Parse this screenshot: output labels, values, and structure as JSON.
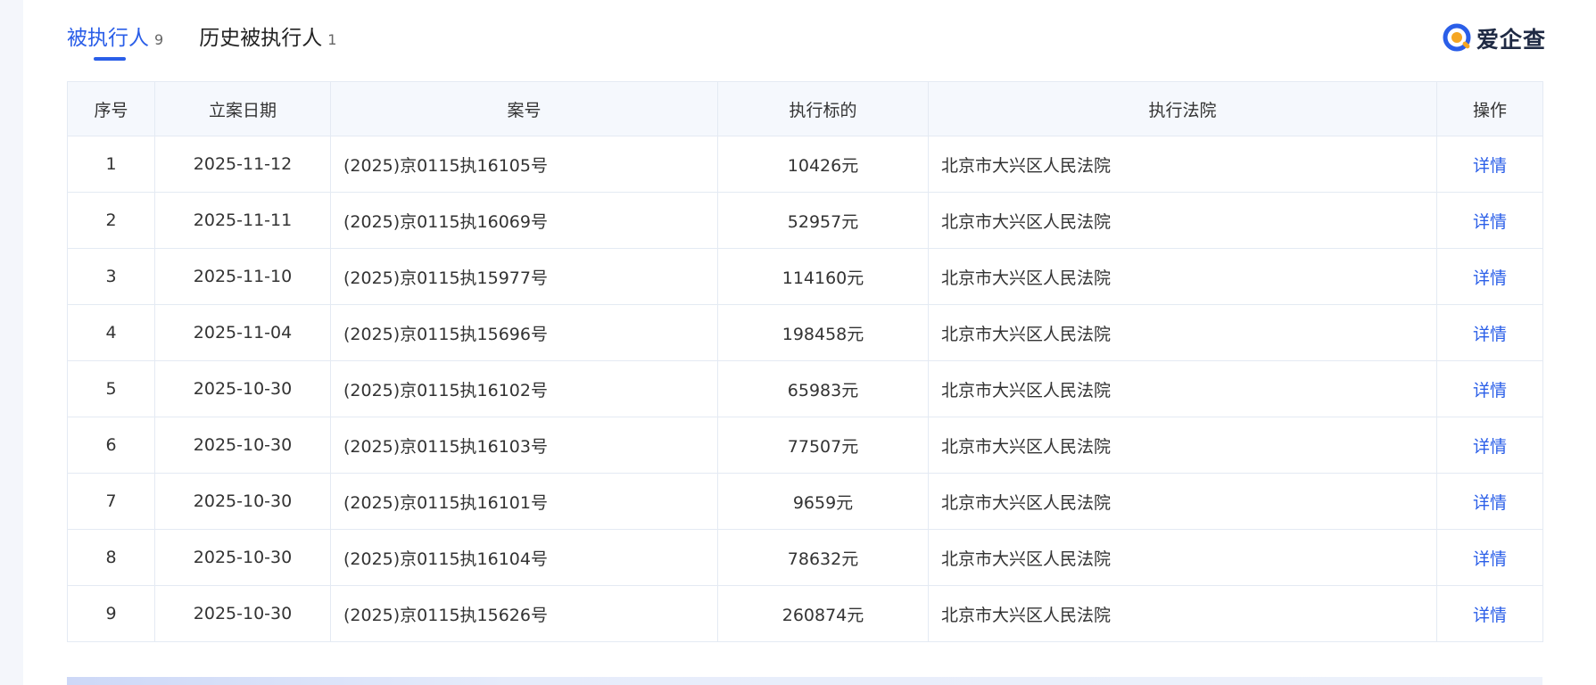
{
  "tabs": [
    {
      "label": "被执行人",
      "count": "9",
      "active": true
    },
    {
      "label": "历史被执行人",
      "count": "1",
      "active": false
    }
  ],
  "brand": {
    "name": "爱企查",
    "accent": "#2a5ee8",
    "logo_colors": [
      "#2a5ee8",
      "#f5a623"
    ]
  },
  "table": {
    "headers": {
      "index": "序号",
      "date": "立案日期",
      "case_no": "案号",
      "amount": "执行标的",
      "court": "执行法院",
      "action": "操作"
    },
    "rows": [
      {
        "index": "1",
        "date": "2025-11-12",
        "case_no": "(2025)京0115执16105号",
        "amount": "10426元",
        "court": "北京市大兴区人民法院",
        "action": "详情"
      },
      {
        "index": "2",
        "date": "2025-11-11",
        "case_no": "(2025)京0115执16069号",
        "amount": "52957元",
        "court": "北京市大兴区人民法院",
        "action": "详情"
      },
      {
        "index": "3",
        "date": "2025-11-10",
        "case_no": "(2025)京0115执15977号",
        "amount": "114160元",
        "court": "北京市大兴区人民法院",
        "action": "详情"
      },
      {
        "index": "4",
        "date": "2025-11-04",
        "case_no": "(2025)京0115执15696号",
        "amount": "198458元",
        "court": "北京市大兴区人民法院",
        "action": "详情"
      },
      {
        "index": "5",
        "date": "2025-10-30",
        "case_no": "(2025)京0115执16102号",
        "amount": "65983元",
        "court": "北京市大兴区人民法院",
        "action": "详情"
      },
      {
        "index": "6",
        "date": "2025-10-30",
        "case_no": "(2025)京0115执16103号",
        "amount": "77507元",
        "court": "北京市大兴区人民法院",
        "action": "详情"
      },
      {
        "index": "7",
        "date": "2025-10-30",
        "case_no": "(2025)京0115执16101号",
        "amount": "9659元",
        "court": "北京市大兴区人民法院",
        "action": "详情"
      },
      {
        "index": "8",
        "date": "2025-10-30",
        "case_no": "(2025)京0115执16104号",
        "amount": "78632元",
        "court": "北京市大兴区人民法院",
        "action": "详情"
      },
      {
        "index": "9",
        "date": "2025-10-30",
        "case_no": "(2025)京0115执15626号",
        "amount": "260874元",
        "court": "北京市大兴区人民法院",
        "action": "详情"
      }
    ]
  }
}
